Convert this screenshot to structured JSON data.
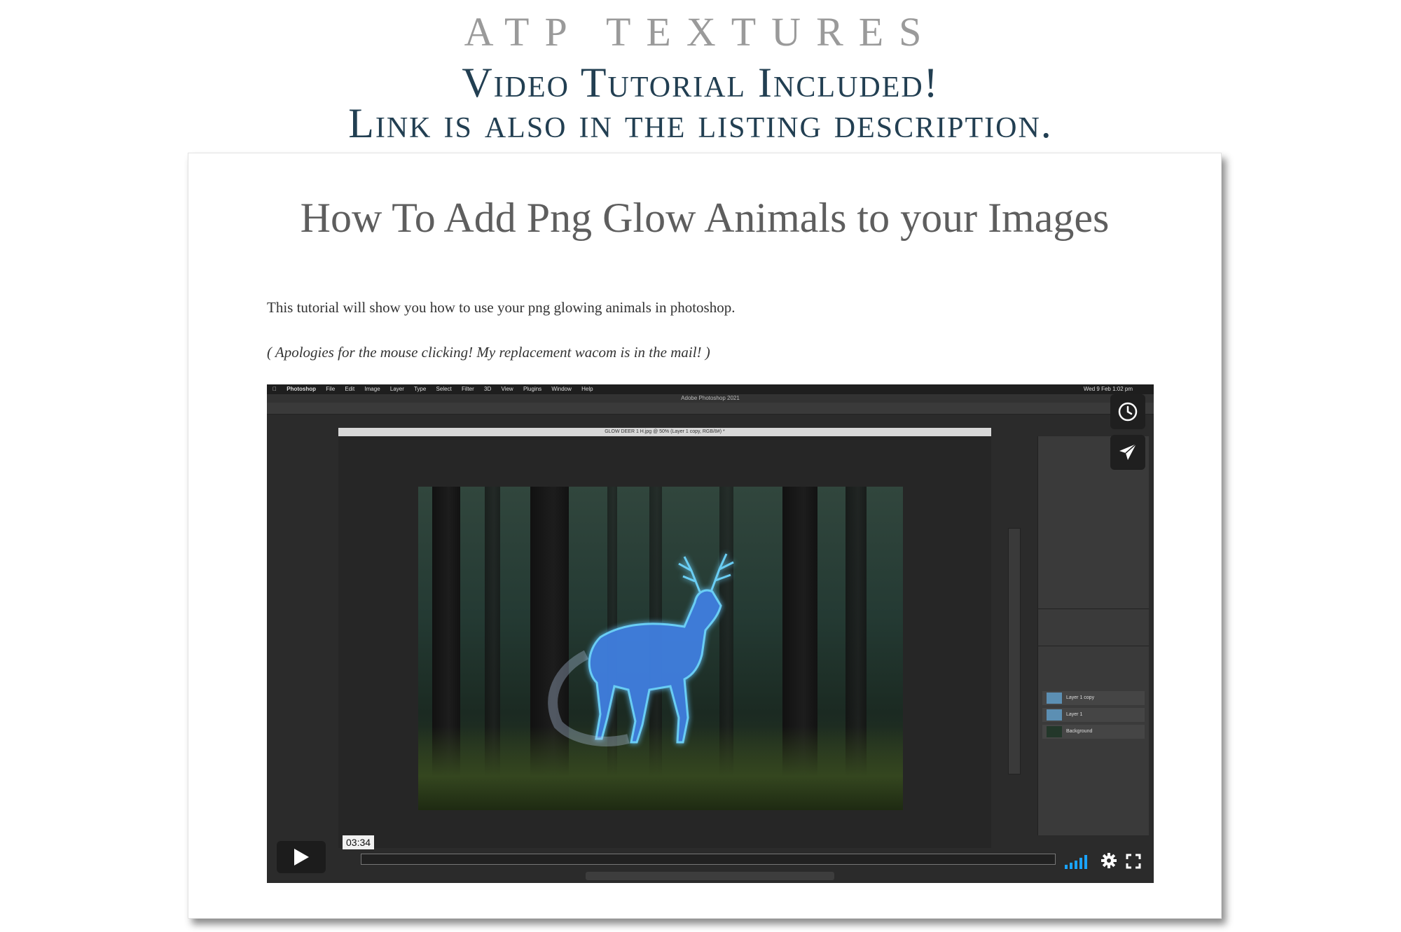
{
  "header": {
    "brand": "ATP TEXTURES",
    "line1": "Video Tutorial Included!",
    "line2": "Link is also in the listing description."
  },
  "card": {
    "title": "How To Add Png Glow Animals to your Images",
    "paragraph1": "This tutorial will show you how to use your png glowing animals in photoshop.",
    "paragraph2": "( Apologies for the mouse clicking! My replacement wacom is in the mail! )"
  },
  "video": {
    "timestamp": "03:34",
    "progress": 0,
    "colors": {
      "accent": "#1aa3ff",
      "header_text": "#223f52",
      "brand_text": "#9a9a9a"
    },
    "icons": [
      "play-icon",
      "clock-icon",
      "send-icon",
      "volume-bars-icon",
      "gear-icon",
      "fullscreen-icon"
    ],
    "screen": {
      "menubar": [
        "Photoshop",
        "File",
        "Edit",
        "Image",
        "Layer",
        "Type",
        "Select",
        "Filter",
        "3D",
        "View",
        "Plugins",
        "Window",
        "Help"
      ],
      "clock": "Wed 9 Feb 1:02 pm",
      "app_title": "Adobe Photoshop 2021",
      "doc_title": "GLOW DEER 1 H.jpg @ 50% (Layer 1 copy, RGB/8#) *",
      "layers": [
        "Layer 1 copy",
        "Layer 1",
        "Background"
      ]
    }
  }
}
